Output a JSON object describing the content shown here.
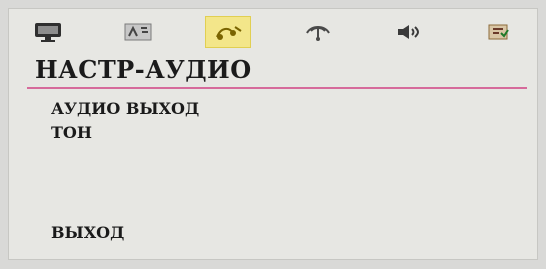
{
  "tabs": [
    {
      "icon": "monitor-icon",
      "active": false
    },
    {
      "icon": "language-icon",
      "active": false
    },
    {
      "icon": "audio-settings-icon",
      "active": true
    },
    {
      "icon": "antenna-icon",
      "active": false
    },
    {
      "icon": "speaker-icon",
      "active": false
    },
    {
      "icon": "rating-icon",
      "active": false
    }
  ],
  "page": {
    "title": "НАСТР-АУДИО"
  },
  "menu": {
    "items": [
      {
        "label": "АУДИО ВЫХОД"
      },
      {
        "label": "ТОН"
      },
      {
        "label": "ВЫХОД"
      }
    ]
  },
  "colors": {
    "accent": "#d66b9b",
    "tab_active_bg": "#f3e68a"
  }
}
